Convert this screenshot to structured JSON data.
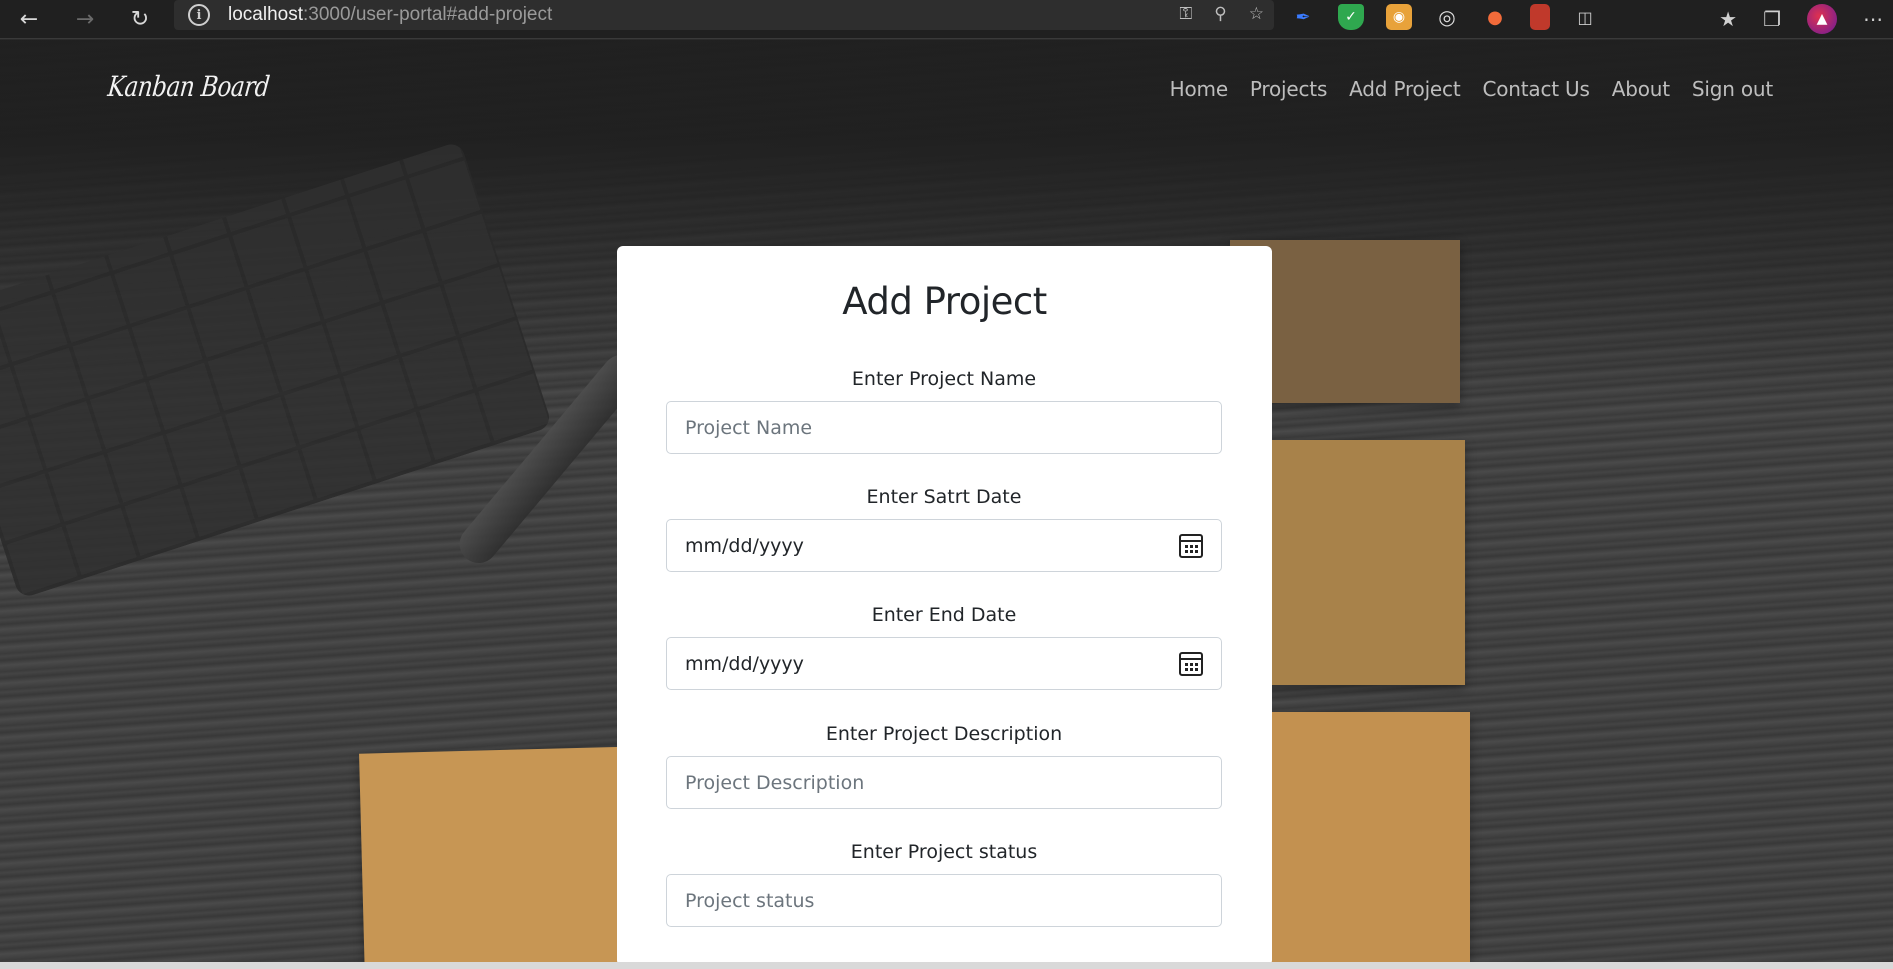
{
  "browser": {
    "url_host": "localhost",
    "url_path": ":3000/user-portal#add-project"
  },
  "navbar": {
    "brand": "Kanban Board",
    "links": [
      "Home",
      "Projects",
      "Add Project",
      "Contact Us",
      "About",
      "Sign out"
    ]
  },
  "form": {
    "title": "Add Project",
    "fields": [
      {
        "label": "Enter Project Name",
        "placeholder": "Project Name",
        "type": "text"
      },
      {
        "label": "Enter Satrt Date",
        "placeholder": "mm/dd/yyyy",
        "type": "date"
      },
      {
        "label": "Enter End Date",
        "placeholder": "mm/dd/yyyy",
        "type": "date"
      },
      {
        "label": "Enter Project Description",
        "placeholder": "Project Description",
        "type": "text"
      },
      {
        "label": "Enter Project status",
        "placeholder": "Project status",
        "type": "text"
      }
    ]
  }
}
